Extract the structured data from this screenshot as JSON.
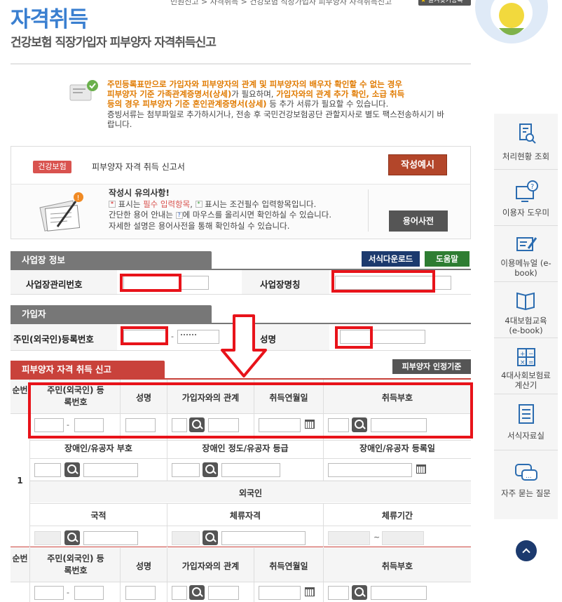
{
  "header": {
    "title": "자격취득",
    "subtitle": "건강보험 직장가입자 피부양자 자격취득신고",
    "breadcrumb": "민원신고 > 자격취득 > 건강보험 직장가입자 피부양자 자격취득신고",
    "favorite": "즐겨찾기등록"
  },
  "notice": {
    "line1": "주민등록표만으로 가입자와 피부양자의 관계 및 피부양자의 배우자 확인할 수 없는 경우",
    "line2a": "피부양자 기준 가족관계증명서(상세)",
    "line2b": "가 필요하며, ",
    "line2c": "가입자와의 관계 추가 확인, 소급 취득",
    "line3a": "등의 경우 피부양자 기준 혼인관계증명서(상세)",
    "line3b": " 등 추가 서류가 필요할 수 있습니다.",
    "line4": "증빙서류는 첨부파일로 추가하시거나, 전송 후 국민건강보험공단 관할지사로 별도 팩스전송하시기 바",
    "line5": "랍니다."
  },
  "form_box": {
    "tag": "건강보험",
    "form_name": "피부양자 자격 취득 신고서",
    "example_button": "작성예시",
    "caution_title": "작성시 유의사항!",
    "caution_l1a": "표시는 ",
    "caution_l1b": "필수 입력항목",
    "caution_l1c": ", ",
    "caution_l1d": "표시는 조건필수 입력항목입니다.",
    "caution_l2a": "간단한 용어 안내는 ",
    "caution_l2b": "에 마우스를 올리시면 확인하실 수 있습니다.",
    "caution_l3": "자세한 설명은 용어사전을 통해 확인하실 수 있습니다.",
    "dict_button": "용어사전"
  },
  "workplace": {
    "section": "사업장 정보",
    "download_button": "서식다운로드",
    "help_button": "도움말",
    "mgmt_no_label": "사업장관리번호",
    "name_label": "사업장명칭"
  },
  "subscriber": {
    "section": "가입자",
    "reg_no_label": "주민(외국인)등록번호",
    "dash": "-",
    "name_label": "성명"
  },
  "dependent": {
    "section": "피부양자 자격 취득 신고",
    "criteria_button": "피부양자 인정기준",
    "col_seq": "순번",
    "col_reg": "주민(외국인) 등록번호",
    "col_name": "성명",
    "col_rel": "가입자와의 관계",
    "col_date": "취득연월일",
    "col_code": "취득부호",
    "col_disab_code": "장애인/유공자 부호",
    "col_disab_grade": "장애인 정도/유공자 등급",
    "col_disab_date": "장애인/유공자 등록일",
    "foreigner": "외국인",
    "col_nation": "국적",
    "col_stay": "체류자격",
    "col_period": "체류기간",
    "row_num": "1",
    "tilde": "~",
    "dash": "-"
  },
  "sidebar": [
    {
      "label": "처리현황 조회",
      "icon": "document-search-icon"
    },
    {
      "label": "이용자 도우미",
      "icon": "monitor-help-icon"
    },
    {
      "label": "이용메뉴얼 (e-book)",
      "icon": "manual-edit-icon"
    },
    {
      "label": "4대보험교육 (e-book)",
      "icon": "open-book-icon"
    },
    {
      "label": "4대사회보험료 계산기",
      "icon": "calculator-icon"
    },
    {
      "label": "서식자료실",
      "icon": "form-list-icon"
    },
    {
      "label": "자주 묻는 질문",
      "icon": "faq-bubble-icon"
    }
  ],
  "colors": {
    "title": "#3a7fd0",
    "accent_red": "#c9423b",
    "highlight": "#e8131a",
    "orange": "#e07a00"
  }
}
